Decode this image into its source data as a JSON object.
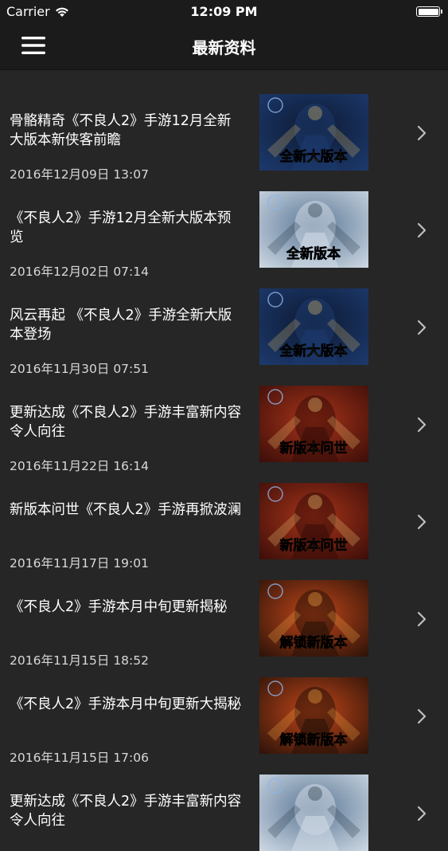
{
  "status_bar": {
    "carrier": "Carrier",
    "time": "12:09 PM",
    "battery_level": 1.0
  },
  "nav": {
    "title": "最新资料",
    "menu_icon": "hamburger-menu-icon"
  },
  "articles": [
    {
      "title": "骨骼精奇《不良人2》手游12月全新大版本新侠客前瞻",
      "date": "2016年12月09日 13:07",
      "thumb_caption": "全新大版本",
      "thumb_colors": [
        "#1d3a6e",
        "#0d1a33",
        "#e8c26a"
      ]
    },
    {
      "title": "《不良人2》手游12月全新大版本预览",
      "date": "2016年12月02日 07:14",
      "thumb_caption": "全新版本",
      "thumb_colors": [
        "#cfd9e4",
        "#5b7896",
        "#1a2a3a"
      ]
    },
    {
      "title": "风云再起 《不良人2》手游全新大版本登场",
      "date": "2016年11月30日 07:51",
      "thumb_caption": "全新大版本",
      "thumb_colors": [
        "#1d3a6e",
        "#0d1a33",
        "#e8c26a"
      ]
    },
    {
      "title": "更新达成《不良人2》手游丰富新内容令人向往",
      "date": "2016年11月22日 16:14",
      "thumb_caption": "新版本问世",
      "thumb_colors": [
        "#3a0d08",
        "#a8341a",
        "#f3d27a"
      ]
    },
    {
      "title": "新版本问世《不良人2》手游再掀波澜",
      "date": "2016年11月17日 19:01",
      "thumb_caption": "新版本问世",
      "thumb_colors": [
        "#3a0d08",
        "#a8341a",
        "#f3d27a"
      ]
    },
    {
      "title": "《不良人2》手游本月中旬更新揭秘",
      "date": "2016年11月15日 18:52",
      "thumb_caption": "解锁新版本",
      "thumb_colors": [
        "#2a1208",
        "#c0461a",
        "#ffb347"
      ]
    },
    {
      "title": "《不良人2》手游本月中旬更新大揭秘",
      "date": "2016年11月15日 17:06",
      "thumb_caption": "解锁新版本",
      "thumb_colors": [
        "#2a1208",
        "#c0461a",
        "#ffb347"
      ]
    },
    {
      "title": "更新达成《不良人2》手游丰富新内容令人向往",
      "date": "",
      "thumb_caption": "",
      "thumb_colors": [
        "#cfd9e4",
        "#5b7896",
        "#1a2a3a"
      ]
    }
  ],
  "colors": {
    "background": "#262626",
    "bar": "#1b1b1b",
    "text": "#ffffff",
    "date_text": "#d8d8d8",
    "chevron": "#bfbfbf"
  }
}
